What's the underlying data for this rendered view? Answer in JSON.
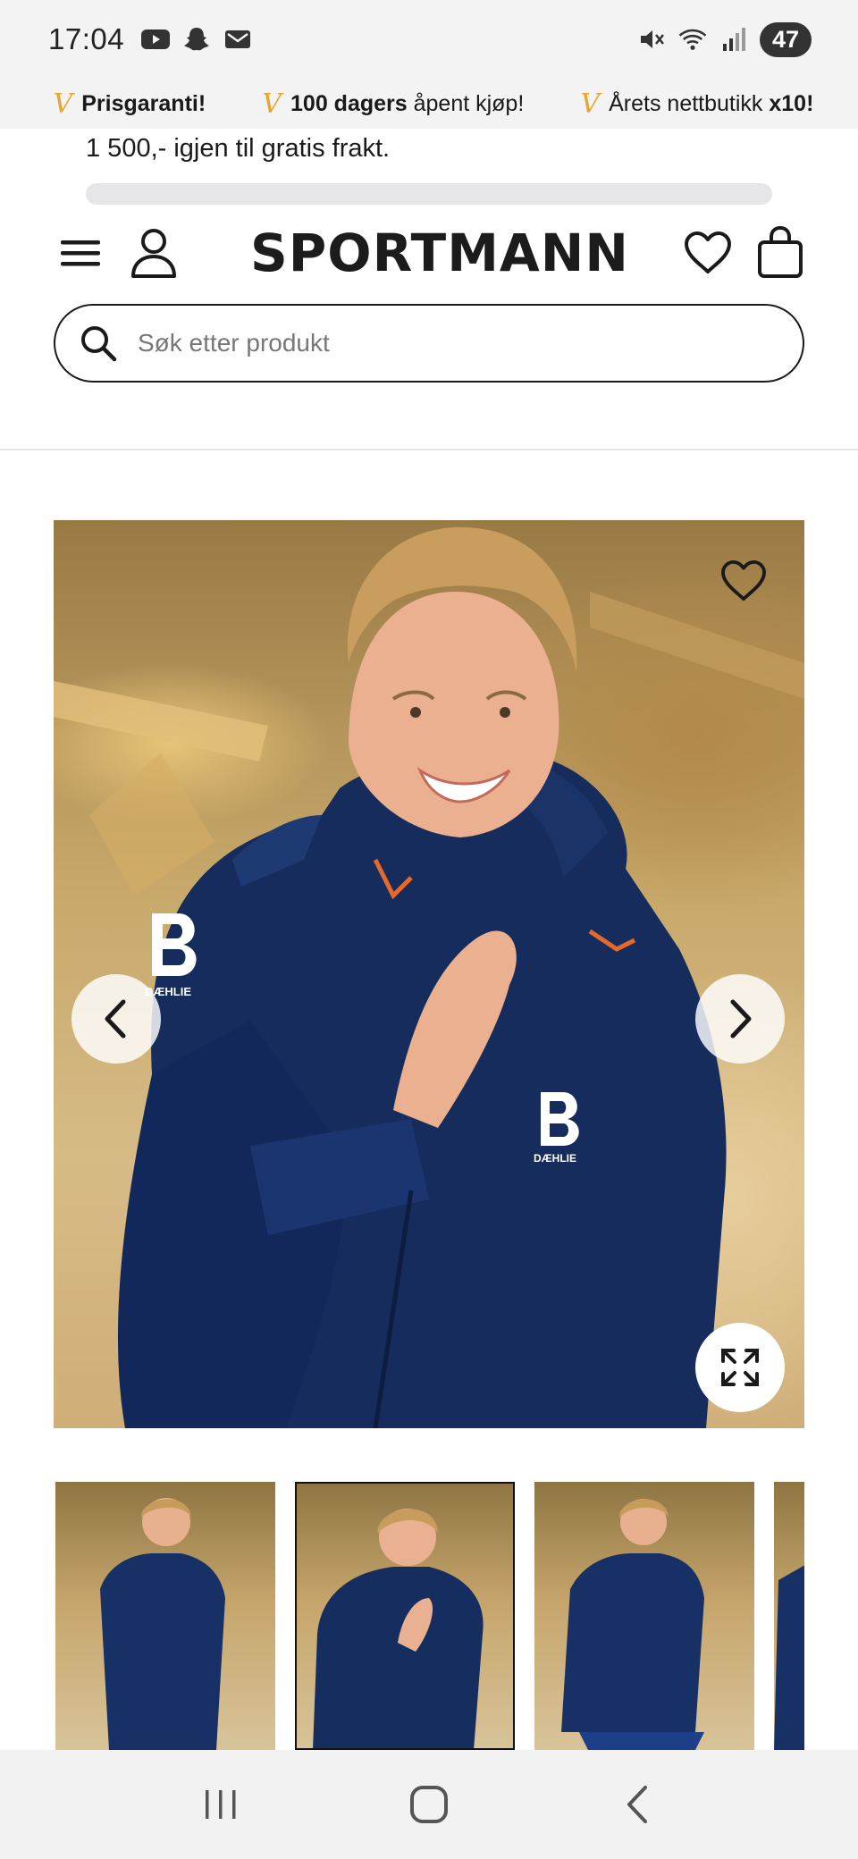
{
  "status_bar": {
    "time": "17:04",
    "battery": "47",
    "left_icons": [
      "youtube-icon",
      "snapchat-icon",
      "mail-icon"
    ],
    "right_icons": [
      "mute-icon",
      "wifi-icon",
      "signal-icon"
    ]
  },
  "promo_bar": {
    "items": [
      {
        "bold": "Prisgaranti!",
        "rest": ""
      },
      {
        "bold": "100 dagers",
        "rest": " åpent kjøp!"
      },
      {
        "pre": "Årets nettbutikk ",
        "bold": "x10!"
      }
    ],
    "check_color": "#e5a531"
  },
  "shipping": {
    "text": "1 500,- igjen til gratis frakt.",
    "progress": 0
  },
  "header": {
    "logo": "SPORTMANN",
    "icons": [
      "menu-icon",
      "user-icon",
      "heart-icon",
      "cart-icon"
    ]
  },
  "search": {
    "placeholder": "Søk etter produkt"
  },
  "product": {
    "image_alt": "Daehlie jacket product photo",
    "brand_mark": "DÆHLIE"
  },
  "thumbnails": {
    "count_visible": 4,
    "selected_index": 1
  },
  "nav_bar": {
    "icons": [
      "recent-apps-icon",
      "home-icon",
      "back-icon"
    ]
  }
}
